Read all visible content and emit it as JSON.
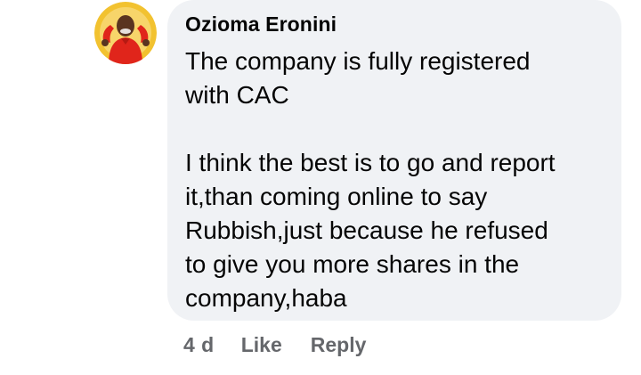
{
  "comment": {
    "author": "Ozioma Eronini",
    "paragraphs": [
      "The company is fully registered\nwith CAC",
      "I think the best is to go and report\nit,than coming online to say\nRubbish,just because he refused\nto give you more shares in the\ncompany,haba"
    ],
    "timestamp": "4 d",
    "like_label": "Like",
    "reply_label": "Reply"
  },
  "colors": {
    "bubble": "#f0f2f5",
    "text": "#050505",
    "meta": "#65676b",
    "avatar_ring": "#f2c230",
    "avatar_shirt": "#e0251b"
  },
  "icons": {
    "avatar": "profile-photo"
  }
}
